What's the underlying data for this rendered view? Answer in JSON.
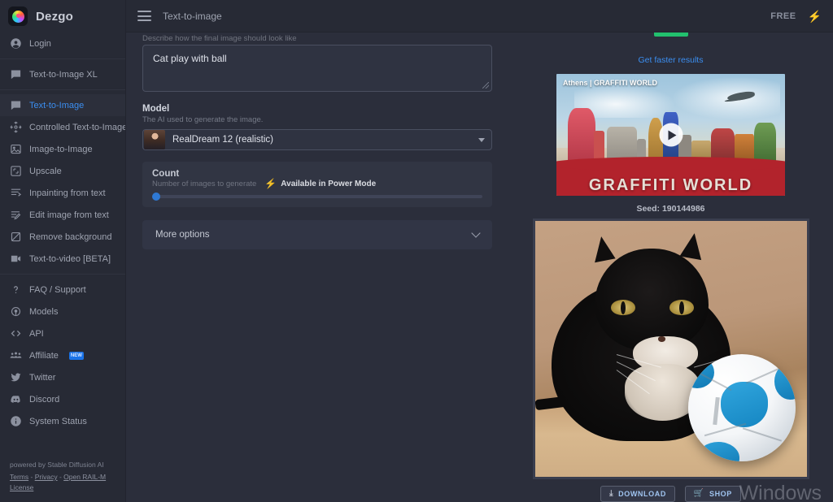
{
  "brand": {
    "name": "Dezgo",
    "logo_icon": "dezgo-orb-logo"
  },
  "sidebar": {
    "account": {
      "label": "Login",
      "icon": "account-circle-icon"
    },
    "groups": [
      {
        "items": [
          {
            "label": "Text-to-Image XL",
            "icon": "chat-bubble-icon",
            "active": false
          }
        ]
      },
      {
        "items": [
          {
            "label": "Text-to-Image",
            "icon": "chat-bubble-icon",
            "active": true
          },
          {
            "label": "Controlled Text-to-Image",
            "icon": "control-nodes-icon",
            "active": false
          },
          {
            "label": "Image-to-Image",
            "icon": "image-icon",
            "active": false
          },
          {
            "label": "Upscale",
            "icon": "expand-arrows-icon",
            "active": false
          },
          {
            "label": "Inpainting from text",
            "icon": "inpaint-lines-icon",
            "active": false
          },
          {
            "label": "Edit image from text",
            "icon": "edit-pencil-lines-icon",
            "active": false
          },
          {
            "label": "Remove background",
            "icon": "no-background-icon",
            "active": false
          },
          {
            "label": "Text-to-video [BETA]",
            "icon": "video-camera-icon",
            "active": false
          }
        ]
      },
      {
        "items": [
          {
            "label": "FAQ / Support",
            "icon": "question-mark-icon",
            "active": false
          },
          {
            "label": "Models",
            "icon": "models-node-icon",
            "active": false
          },
          {
            "label": "API",
            "icon": "code-brackets-icon",
            "active": false
          },
          {
            "label": "Affiliate",
            "icon": "people-group-icon",
            "active": false,
            "badge": "NEW"
          },
          {
            "label": "Twitter",
            "icon": "twitter-bird-icon",
            "active": false
          },
          {
            "label": "Discord",
            "icon": "discord-icon",
            "active": false
          },
          {
            "label": "System Status",
            "icon": "info-circle-icon",
            "active": false
          }
        ]
      }
    ],
    "footer": {
      "powered_by": "powered by Stable Diffusion AI",
      "links": [
        "Terms",
        "Privacy",
        "Open RAIL-M License"
      ],
      "separator": " - "
    }
  },
  "topbar": {
    "menu_icon": "hamburger-menu-icon",
    "title": "Text-to-image",
    "plan": "FREE",
    "bolt_icon": "lightning-bolt-icon"
  },
  "form": {
    "prompt": {
      "hint": "Describe how the final image should look like",
      "value": "Cat play with ball",
      "placeholder": "Describe how the final image should look like"
    },
    "model": {
      "label": "Model",
      "sub": "The AI used to generate the image.",
      "value": "RealDream 12 (realistic)",
      "caret_icon": "caret-down-icon"
    },
    "count": {
      "label": "Count",
      "sub": "Number of images to generate",
      "power_note": "Available in Power Mode",
      "power_icon": "lightning-bolt-icon",
      "slider_value": 1
    },
    "more_options": {
      "label": "More options",
      "chevron_icon": "chevron-down-icon"
    }
  },
  "result": {
    "faster_link": "Get faster results",
    "progress_percent": 100,
    "ad": {
      "title": "Athens | GRAFFITI WORLD",
      "big_text": "GRAFFITI  WORLD",
      "play_icon": "play-button-icon"
    },
    "seed": "Seed: 190144986",
    "buttons": [
      {
        "label": "DOWNLOAD",
        "icon": "download-icon"
      },
      {
        "label": "SHOP",
        "icon": "shopping-cart-icon"
      }
    ],
    "watermark": {
      "line1": "Windows",
      "line2": ""
    }
  },
  "colors": {
    "accent_blue": "#3b8ef0",
    "sidebar_bg": "#272a35",
    "main_bg": "#2b2e3b",
    "progress_green": "#22c06e",
    "power_green": "#2fd07a"
  }
}
